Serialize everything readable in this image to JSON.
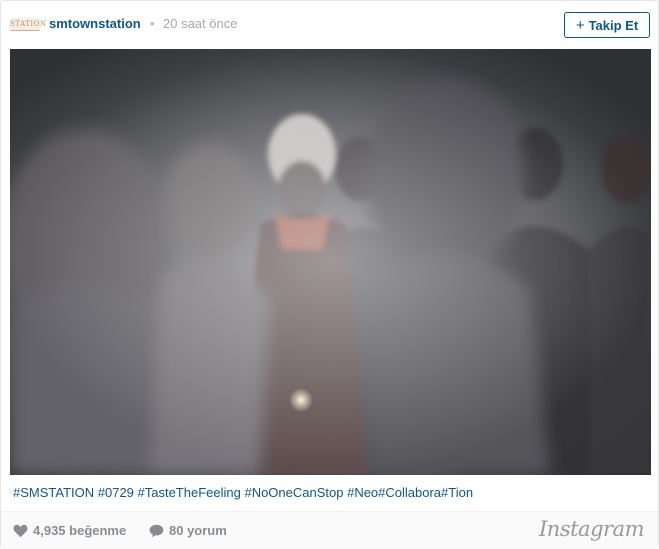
{
  "header": {
    "avatar_text": "STATION",
    "username": "smtownstation",
    "separator": "•",
    "timestamp": "20 saat önce",
    "follow_label": "Takip Et",
    "follow_icon": "plus-icon"
  },
  "post": {
    "caption": "#SMSTATION #0729 #TasteTheFeeling #NoOneCanStop #Neo#Collabora#Tion"
  },
  "footer": {
    "likes": "4,935 beğenme",
    "likes_icon": "heart-icon",
    "comments": "80 yorum",
    "comments_icon": "speech-bubble-icon",
    "brand": "Instagram"
  },
  "colors": {
    "link_blue": "#125688",
    "muted_gray": "#a5a7aa",
    "footer_bg": "#fafafa"
  }
}
